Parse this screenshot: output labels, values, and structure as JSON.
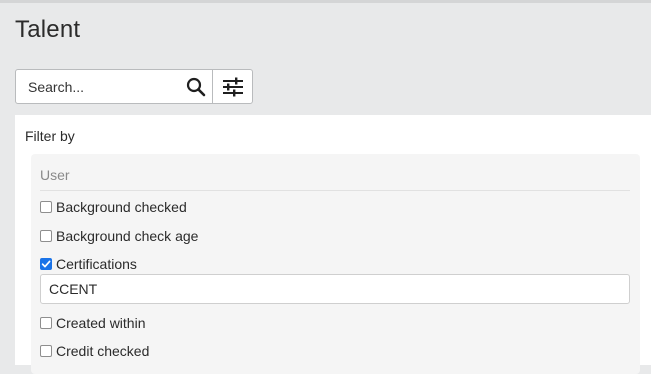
{
  "page": {
    "title": "Talent"
  },
  "search": {
    "placeholder": "Search...",
    "value": ""
  },
  "filters": {
    "heading": "Filter by",
    "group_label": "User",
    "options": [
      {
        "label": "Background checked",
        "checked": false
      },
      {
        "label": "Background check age",
        "checked": false
      },
      {
        "label": "Certifications",
        "checked": true
      },
      {
        "label": "Created within",
        "checked": false
      },
      {
        "label": "Credit checked",
        "checked": false
      }
    ],
    "certifications_value": "CCENT"
  },
  "colors": {
    "accent": "#1a73e8",
    "background": "#e8e9ea"
  },
  "icons": {
    "search": "search-icon",
    "filter": "sliders-icon",
    "check": "checkmark-icon"
  }
}
